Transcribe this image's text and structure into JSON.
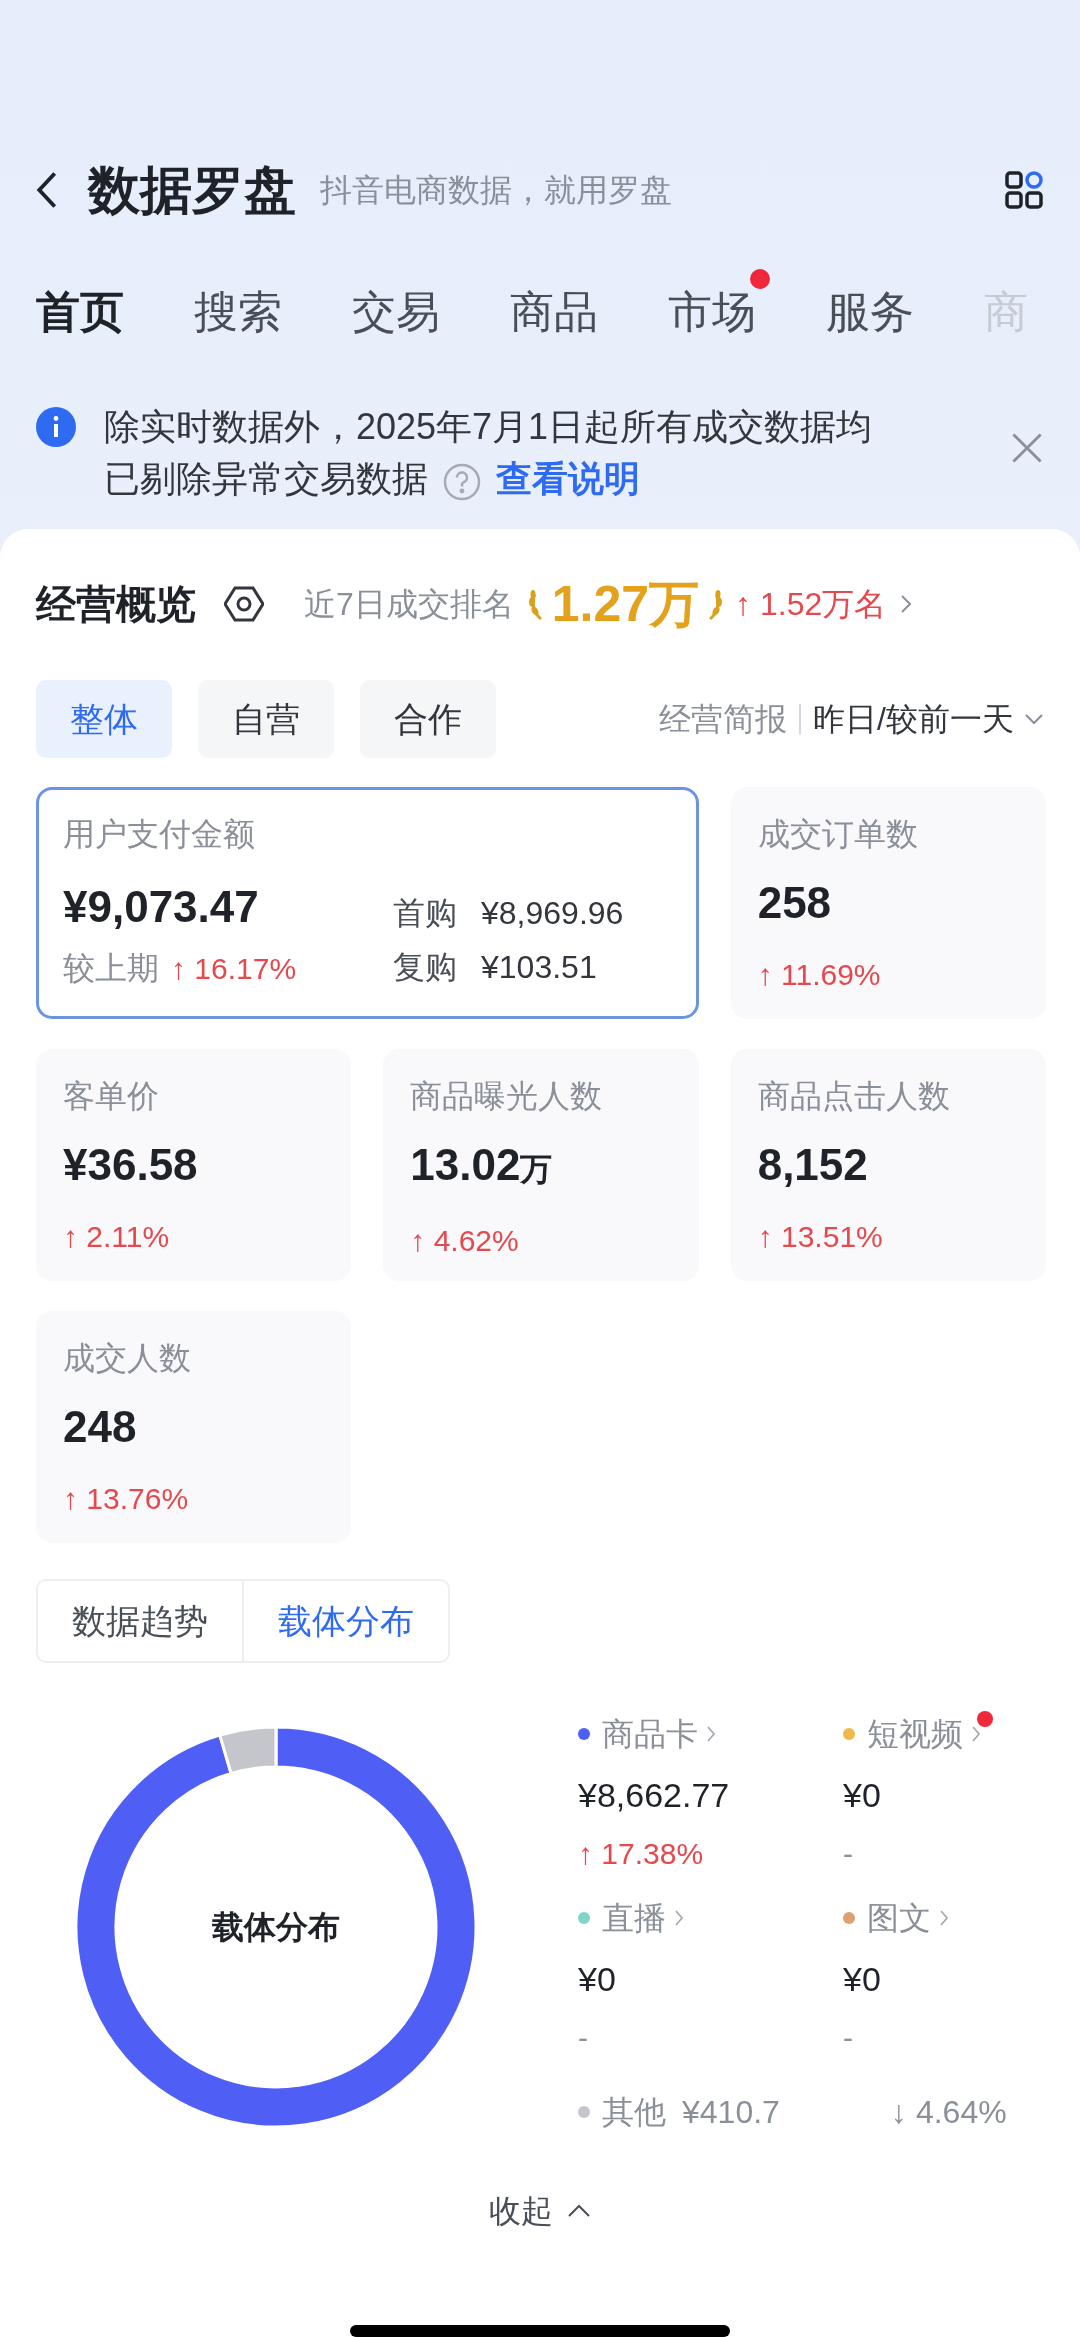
{
  "header": {
    "title": "数据罗盘",
    "subtitle": "抖音电商数据，就用罗盘"
  },
  "tabs": [
    {
      "label": "首页",
      "selected": true,
      "dot": false,
      "faded": false
    },
    {
      "label": "搜索",
      "selected": false,
      "dot": false,
      "faded": false
    },
    {
      "label": "交易",
      "selected": false,
      "dot": false,
      "faded": false
    },
    {
      "label": "商品",
      "selected": false,
      "dot": false,
      "faded": false
    },
    {
      "label": "市场",
      "selected": false,
      "dot": true,
      "faded": false
    },
    {
      "label": "服务",
      "selected": false,
      "dot": false,
      "faded": false
    },
    {
      "label": "商",
      "selected": false,
      "dot": false,
      "faded": true
    }
  ],
  "notice": {
    "text": "除实时数据外，2025年7月1日起所有成交数据均已剔除异常交易数据",
    "link": "查看说明"
  },
  "overview": {
    "title": "经营概览",
    "rank_label": "近7日成交排名",
    "rank_value": "1.27万",
    "rank_change": {
      "text": "↑ 1.52万名",
      "color": "#e5484d"
    }
  },
  "segments": [
    {
      "label": "整体",
      "selected": true
    },
    {
      "label": "自营",
      "selected": false
    },
    {
      "label": "合作",
      "selected": false
    }
  ],
  "report": {
    "label": "经营简报",
    "period": "昨日/较前一天"
  },
  "metrics": [
    {
      "kind": "main",
      "label": "用户支付金额",
      "value": "¥9,073.47",
      "compare_label": "较上期",
      "change": {
        "text": "↑ 16.17%",
        "color": "#e5484d"
      },
      "selected": true,
      "details": [
        {
          "label": "首购",
          "value": "¥8,969.96"
        },
        {
          "label": "复购",
          "value": "¥103.51"
        }
      ]
    },
    {
      "kind": "plain",
      "label": "成交订单数",
      "value": "258",
      "change": {
        "text": "↑ 11.69%",
        "color": "#e5484d"
      },
      "selected": false
    },
    {
      "kind": "plain",
      "label": "客单价",
      "value": "¥36.58",
      "change": {
        "text": "↑ 2.11%",
        "color": "#e5484d"
      },
      "selected": false
    },
    {
      "kind": "plain",
      "label": "商品曝光人数",
      "value": "13.02",
      "unit": "万",
      "change": {
        "text": "↑ 4.62%",
        "color": "#e5484d"
      },
      "selected": false
    },
    {
      "kind": "plain",
      "label": "商品点击人数",
      "value": "8,152",
      "change": {
        "text": "↑ 13.51%",
        "color": "#e5484d"
      },
      "selected": false
    },
    {
      "kind": "plain",
      "label": "成交人数",
      "value": "248",
      "change": {
        "text": "↑ 13.76%",
        "color": "#e5484d"
      },
      "selected": false
    }
  ],
  "view_tabs": [
    {
      "label": "数据趋势",
      "selected": false
    },
    {
      "label": "载体分布",
      "selected": true
    }
  ],
  "distribution": {
    "chart_data": {
      "type": "donut",
      "title": "载体分布",
      "values": [
        95.47,
        4.53
      ],
      "colors": [
        "#4f5ff5",
        "#c4c6cc"
      ]
    },
    "channels": [
      {
        "name": "商品卡",
        "color": "#4f5ff5",
        "amount": "¥8,662.77",
        "change": {
          "text": "↑ 17.38%",
          "color": "#e5484d"
        },
        "dot": false
      },
      {
        "name": "短视频",
        "color": "#f0b94a",
        "amount": "¥0",
        "change": {
          "text": "-",
          "color": "#8a8f99"
        },
        "dot": true
      },
      {
        "name": "直播",
        "color": "#7fd6c8",
        "amount": "¥0",
        "change": {
          "text": "-",
          "color": "#8a8f99"
        },
        "dot": false
      },
      {
        "name": "图文",
        "color": "#e0a070",
        "amount": "¥0",
        "change": {
          "text": "-",
          "color": "#8a8f99"
        },
        "dot": false
      }
    ],
    "other": {
      "name": "其他",
      "color": "#c4c6cc",
      "amount": "¥410.7",
      "change": {
        "text": "↓ 4.64%",
        "color": "#8a8f99"
      }
    }
  },
  "collapse": {
    "label": "收起"
  }
}
